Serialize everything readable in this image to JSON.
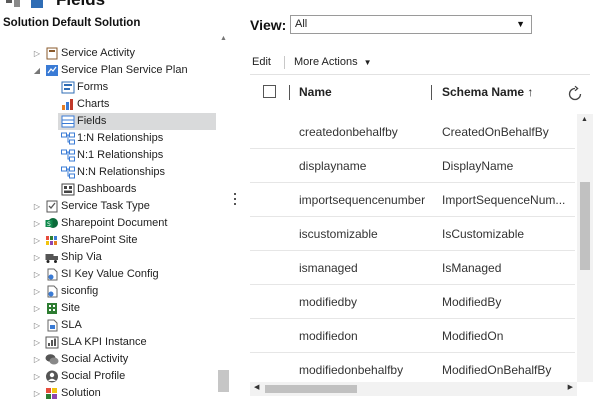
{
  "header": {
    "title": "Fields"
  },
  "solution_title": "Solution Default Solution",
  "tree": [
    {
      "label": "Service Activity",
      "indent": 1,
      "arrow": "▷",
      "icon": "calendar-icon",
      "color": "#8a5a2b"
    },
    {
      "label": "Service Plan Service Plan",
      "indent": 1,
      "arrow": "◢",
      "icon": "entity-icon",
      "color": "#3a7bd5"
    },
    {
      "label": "Forms",
      "indent": 2,
      "arrow": "",
      "icon": "forms-icon",
      "color": "#2f6db5"
    },
    {
      "label": "Charts",
      "indent": 2,
      "arrow": "",
      "icon": "charts-icon",
      "color": "#e67e22"
    },
    {
      "label": "Fields",
      "indent": 2,
      "arrow": "",
      "icon": "fields-icon",
      "color": "#3a7bd5",
      "selected": true
    },
    {
      "label": "1:N Relationships",
      "indent": 2,
      "arrow": "",
      "icon": "relationship-icon",
      "color": "#3a7bd5"
    },
    {
      "label": "N:1 Relationships",
      "indent": 2,
      "arrow": "",
      "icon": "relationship-icon",
      "color": "#3a7bd5"
    },
    {
      "label": "N:N Relationships",
      "indent": 2,
      "arrow": "",
      "icon": "relationship-icon",
      "color": "#3a7bd5"
    },
    {
      "label": "Dashboards",
      "indent": 2,
      "arrow": "",
      "icon": "dashboard-icon",
      "color": "#444444"
    },
    {
      "label": "Service Task Type",
      "indent": 1,
      "arrow": "▷",
      "icon": "task-icon",
      "color": "#555555"
    },
    {
      "label": "Sharepoint Document",
      "indent": 1,
      "arrow": "▷",
      "icon": "sharepoint-icon",
      "color": "#0b6a3a"
    },
    {
      "label": "SharePoint Site",
      "indent": 1,
      "arrow": "▷",
      "icon": "site-icon",
      "color": "#2e7d32"
    },
    {
      "label": "Ship Via",
      "indent": 1,
      "arrow": "▷",
      "icon": "truck-icon",
      "color": "#555555"
    },
    {
      "label": "SI Key Value Config",
      "indent": 1,
      "arrow": "▷",
      "icon": "config-icon",
      "color": "#3a7bd5"
    },
    {
      "label": "siconfig",
      "indent": 1,
      "arrow": "▷",
      "icon": "config-icon",
      "color": "#3a7bd5"
    },
    {
      "label": "Site",
      "indent": 1,
      "arrow": "▷",
      "icon": "building-icon",
      "color": "#2e7d32"
    },
    {
      "label": "SLA",
      "indent": 1,
      "arrow": "▷",
      "icon": "sla-icon",
      "color": "#3a7bd5"
    },
    {
      "label": "SLA KPI Instance",
      "indent": 1,
      "arrow": "▷",
      "icon": "kpi-icon",
      "color": "#555555"
    },
    {
      "label": "Social Activity",
      "indent": 1,
      "arrow": "▷",
      "icon": "chat-icon",
      "color": "#555555"
    },
    {
      "label": "Social Profile",
      "indent": 1,
      "arrow": "▷",
      "icon": "profile-icon",
      "color": "#555555"
    },
    {
      "label": "Solution",
      "indent": 1,
      "arrow": "▷",
      "icon": "puzzle-icon",
      "color": "#8e44ad"
    }
  ],
  "view": {
    "label": "View:",
    "selected": "All"
  },
  "toolbar": {
    "edit": "Edit",
    "more_actions": "More Actions"
  },
  "grid": {
    "columns": [
      "Name",
      "Schema Name ↑"
    ],
    "rows": [
      {
        "name": "createdonbehalfby",
        "schema": "CreatedOnBehalfBy"
      },
      {
        "name": "displayname",
        "schema": "DisplayName"
      },
      {
        "name": "importsequencenumber",
        "schema": "ImportSequenceNum..."
      },
      {
        "name": "iscustomizable",
        "schema": "IsCustomizable"
      },
      {
        "name": "ismanaged",
        "schema": "IsManaged"
      },
      {
        "name": "modifiedby",
        "schema": "ModifiedBy"
      },
      {
        "name": "modifiedon",
        "schema": "ModifiedOn"
      },
      {
        "name": "modifiedonbehalfby",
        "schema": "ModifiedOnBehalfBy"
      }
    ]
  }
}
